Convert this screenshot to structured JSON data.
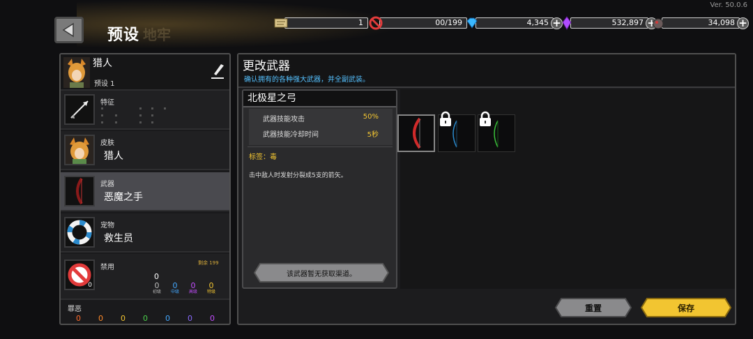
{
  "version": "Ver. 50.0.6",
  "header": {
    "title": "预设",
    "ghost_title": "地牢"
  },
  "resources": [
    {
      "icon": "scroll-icon",
      "value": "1",
      "has_plus": false
    },
    {
      "icon": "ban-icon",
      "value": "00/199",
      "has_plus": false
    },
    {
      "icon": "gem-icon",
      "value": "4,345",
      "has_plus": true
    },
    {
      "icon": "crystal-icon",
      "value": "532,897",
      "has_plus": true
    },
    {
      "icon": "ore-icon",
      "value": "34,098",
      "has_plus": true
    }
  ],
  "character": {
    "name": "猎人",
    "preset": "预设 1"
  },
  "slots": {
    "trait": {
      "label": "特征"
    },
    "skin": {
      "label": "皮肤",
      "value": "猎人"
    },
    "weapon": {
      "label": "武器",
      "value": "恶魔之手"
    },
    "pet": {
      "label": "宠物",
      "value": "救生员"
    },
    "ban": {
      "label": "禁用",
      "remaining": "剩余 199",
      "icon_count": "0",
      "total": "0",
      "levels": [
        {
          "num": "0",
          "label": "初级",
          "color": "#bbbbbb"
        },
        {
          "num": "0",
          "label": "中级",
          "color": "#43a8ff"
        },
        {
          "num": "0",
          "label": "高级",
          "color": "#c44dff"
        },
        {
          "num": "0",
          "label": "特级",
          "color": "#f2c531"
        }
      ]
    },
    "sin": {
      "label": "罪恶",
      "values": [
        "0",
        "0",
        "0",
        "0",
        "0",
        "0",
        "0"
      ],
      "colors": [
        "#ff6a2a",
        "#ff8a2a",
        "#f2c531",
        "#4bd04b",
        "#43a8ff",
        "#8a6bff",
        "#c44dff"
      ]
    }
  },
  "main": {
    "title": "更改武器",
    "subtitle": "确认拥有的各种强大武器，并全副武装。",
    "weapon_detail": {
      "name": "北极星之弓",
      "stats": [
        {
          "key": "武器技能攻击",
          "value": "50%"
        },
        {
          "key": "武器技能冷却时间",
          "value": "5秒"
        }
      ],
      "tag": "标签：毒",
      "description": "击中敌人时发射分裂成5支的箭矢。",
      "acquire_label": "该武器暂无获取渠道。"
    },
    "weapons": [
      {
        "name": "red-bow",
        "color": "#d02a2a",
        "locked": false,
        "selected": true
      },
      {
        "name": "blue-bow",
        "color": "#2a8acd",
        "locked": true,
        "selected": false
      },
      {
        "name": "green-bow",
        "color": "#3ac23a",
        "locked": true,
        "selected": false
      }
    ]
  },
  "buttons": {
    "reset": "重置",
    "save": "保存"
  },
  "colors": {
    "accent_gold": "#f2c531",
    "accent_blue": "#55c1ff"
  }
}
